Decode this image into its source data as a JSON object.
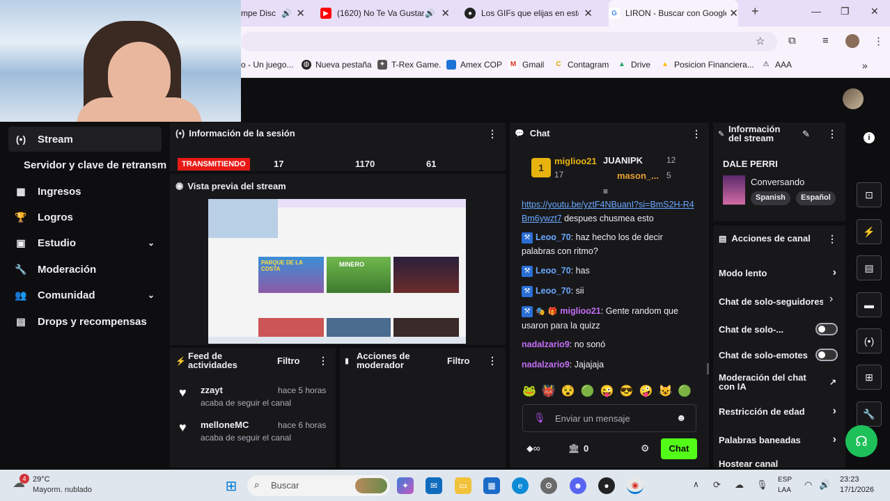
{
  "browser": {
    "tabs": [
      {
        "title": "mpe Disco",
        "color": "#5865f2"
      },
      {
        "title": "(1620) No Te Va Gustar -",
        "color": "#ff0000"
      },
      {
        "title": "Los GIFs que elijas en este t",
        "color": "#d12f63"
      },
      {
        "title": "LIRON - Buscar con Google",
        "color": "#4285f4"
      }
    ],
    "bookmarks": [
      "o - Un juego...",
      "Nueva pestaña",
      "T-Rex Game.",
      "Amex COP",
      "Gmail",
      "Contagram",
      "Drive",
      "Posicion Financiera...",
      "AAA"
    ]
  },
  "leftnav": {
    "items": [
      {
        "label": "Stream",
        "icon": "(•)"
      },
      {
        "label": "Servidor y clave de retransm",
        "icon": ""
      },
      {
        "label": "Ingresos",
        "icon": "▦"
      },
      {
        "label": "Logros",
        "icon": "🏆"
      },
      {
        "label": "Estudio",
        "icon": "▣"
      },
      {
        "label": "Moderación",
        "icon": "🔧"
      },
      {
        "label": "Comunidad",
        "icon": "👥"
      },
      {
        "label": "Drops y recompensas",
        "icon": "▤"
      }
    ]
  },
  "session": {
    "title": "Información de la sesión",
    "live_badge": "TRANSMITIENDO",
    "stat1": "17",
    "stat2": "1170",
    "stat3": "61"
  },
  "preview": {
    "title": "Vista previa del stream",
    "thumb1": "PARQUE DE LA COSTA",
    "thumb2": "MINERO"
  },
  "activity": {
    "title": "Feed de actividades",
    "filter": "Filtro",
    "items": [
      {
        "user": "zzayt",
        "time": "hace 5 horas",
        "desc": "acaba de seguir el canal"
      },
      {
        "user": "melloneMC",
        "time": "hace 6 horas",
        "desc": "acaba de seguir el canal"
      }
    ]
  },
  "modactions": {
    "title": "Acciones de moderador",
    "filter": "Filtro"
  },
  "chat": {
    "title": "Chat",
    "leader": {
      "rank": "1",
      "name": "miglioo21",
      "count": "17"
    },
    "second": {
      "name": "JUANIPK",
      "count": "12"
    },
    "third": {
      "name": "mason_...",
      "count": "5"
    },
    "link": "https://youtu.be/yztF4NBuanI?si=BmS2H-R4Bm6ywzt7",
    "link_tail": " despues chusmea esto",
    "messages": [
      {
        "user": "Leoo_70",
        "text": ": haz hecho los de decir palabras con ritmo?",
        "color": "#6aa9ff"
      },
      {
        "user": "Leoo_70",
        "text": ": has",
        "color": "#6aa9ff"
      },
      {
        "user": "Leoo_70",
        "text": ": sii",
        "color": "#6aa9ff"
      },
      {
        "user": "miglioo21",
        "text": ": Gente random que usaron para la quizz",
        "color": "#c36ef5"
      },
      {
        "user": "nadalzario9",
        "text": ": no sonó",
        "color": "#c36ef5"
      },
      {
        "user": "nadalzario9",
        "text": ": Jajajaja",
        "color": "#c36ef5"
      }
    ],
    "input_placeholder": "Enviar un mensaje",
    "points": "0",
    "send_label": "Chat"
  },
  "streaminfo": {
    "title": "Información del stream",
    "streamer": "DALE PERRI",
    "category": "Conversando",
    "tag1": "Spanish",
    "tag2": "Español"
  },
  "channel": {
    "title": "Acciones de canal",
    "actions": [
      {
        "label": "Modo lento",
        "control": "chevron"
      },
      {
        "label": "Chat de solo-seguidores",
        "control": "chevron"
      },
      {
        "label": "Chat de solo-...",
        "control": "toggle"
      },
      {
        "label": "Chat de solo-emotes",
        "control": "toggle"
      },
      {
        "label": "Moderación del chat con IA",
        "control": "external"
      },
      {
        "label": "Restricción de edad",
        "control": "chevron"
      },
      {
        "label": "Palabras baneadas",
        "control": "chevron"
      },
      {
        "label": "Hostear canal",
        "control": "none"
      }
    ]
  },
  "taskbar": {
    "weather_badge": "4",
    "temp": "29°C",
    "weather": "Mayorm. nublado",
    "search": "Buscar",
    "lang1": "ESP",
    "lang2": "LAA",
    "time": "23:23",
    "date": "17/1/2026"
  },
  "colors": {
    "accent": "#53fc18",
    "live": "#e91916",
    "background": "#0e0e10",
    "panel": "#18181b"
  }
}
